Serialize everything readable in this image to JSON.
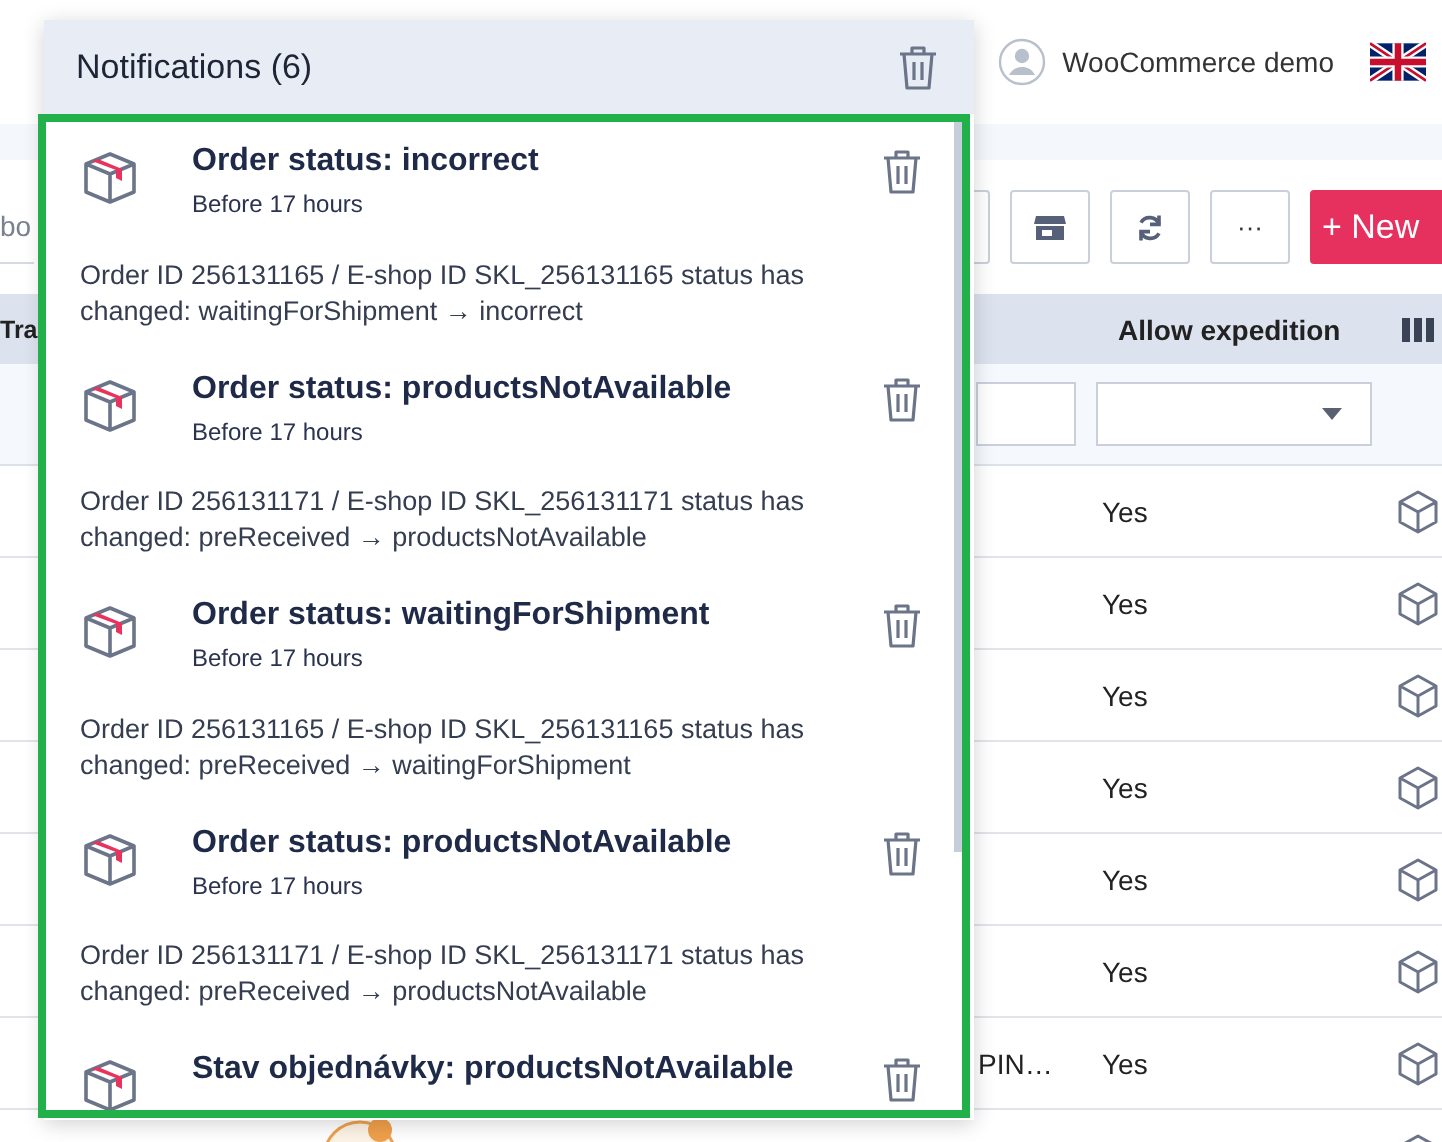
{
  "header": {
    "user_name": "WooCommerce demo"
  },
  "toolbar": {
    "search_placeholder": "bo",
    "more_button": "···",
    "new_button": "+ New"
  },
  "table": {
    "columns": [
      {
        "label": "Tra"
      },
      {
        "label": "Allow expedition"
      }
    ],
    "rows": [
      {
        "allow_expedition": "Yes"
      },
      {
        "allow_expedition": "Yes"
      },
      {
        "allow_expedition": "Yes"
      },
      {
        "allow_expedition": "Yes"
      },
      {
        "allow_expedition": "Yes"
      },
      {
        "allow_expedition": "Yes"
      },
      {
        "column_2": "PIN…",
        "allow_expedition": "Yes"
      }
    ]
  },
  "notifications": {
    "title": "Notifications (6)",
    "items": [
      {
        "title": "Order status: incorrect",
        "time": "Before 17 hours",
        "body": "Order ID 256131165 / E-shop ID SKL_256131165 status has changed: waitingForShipment → incorrect"
      },
      {
        "title": "Order status: productsNotAvailable",
        "time": "Before 17 hours",
        "body": "Order ID 256131171 / E-shop ID SKL_256131171 status has changed: preReceived → productsNotAvailable"
      },
      {
        "title": "Order status: waitingForShipment",
        "time": "Before 17 hours",
        "body": "Order ID 256131165 / E-shop ID SKL_256131165 status has changed: preReceived → waitingForShipment"
      },
      {
        "title": "Order status: productsNotAvailable",
        "time": "Before 17 hours",
        "body": "Order ID 256131171 / E-shop ID SKL_256131171 status has changed: preReceived → productsNotAvailable"
      },
      {
        "title": "Stav objednávky: productsNotAvailable"
      }
    ]
  }
}
